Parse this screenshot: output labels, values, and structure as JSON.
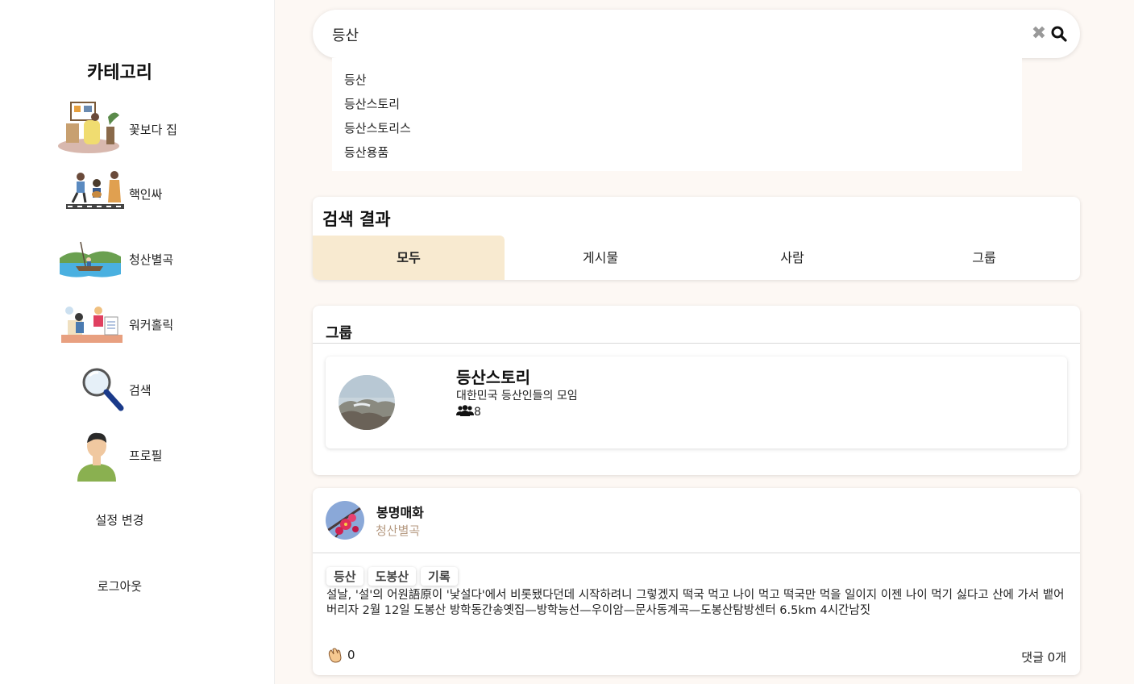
{
  "sidebar": {
    "title": "카테고리",
    "categories": [
      {
        "label": "꽃보다 집",
        "icon": "home-interior-illustration"
      },
      {
        "label": "핵인싸",
        "icon": "music-party-illustration"
      },
      {
        "label": "청산별곡",
        "icon": "boat-nature-illustration"
      },
      {
        "label": "워커홀릭",
        "icon": "office-work-illustration"
      },
      {
        "label": "검색",
        "icon": "magnifier-illustration"
      },
      {
        "label": "프로필",
        "icon": "person-illustration"
      }
    ],
    "settings_label": "설정 변경",
    "logout_label": "로그아웃"
  },
  "search": {
    "value": "등산",
    "suggestions": [
      "등산",
      "등산스토리",
      "등산스토리스",
      "등산용품"
    ]
  },
  "results": {
    "title": "검색 결과",
    "tabs": [
      {
        "label": "모두",
        "active": true
      },
      {
        "label": "게시물",
        "active": false
      },
      {
        "label": "사람",
        "active": false
      },
      {
        "label": "그룹",
        "active": false
      }
    ]
  },
  "groups": {
    "section_title": "그룹",
    "items": [
      {
        "name": "등산스토리",
        "description": "대한민국 등산인들의 모임",
        "members": "8"
      }
    ]
  },
  "post": {
    "author": "봉명매화",
    "category": "청산별곡",
    "tags": [
      "등산",
      "도봉산",
      "기록"
    ],
    "body": "설날, '설'의 어원語原이 '낯설다'에서 비롯됐다던데 시작하려니 그렇겠지 떡국 먹고 나이 먹고 떡국만 먹을 일이지 이젠 나이 먹기 싫다고 산에 가서 뱉어버리자 2월 12일 도봉산 방학동간송옛집—방학능선—우이암—문사동계곡—도봉산탐방센터 6.5km 4시간남짓",
    "likes": "0",
    "comments": "댓글 0개"
  },
  "colors": {
    "background": "#fdf8f4",
    "active_tab": "#f8ead0",
    "category_text": "#b59980"
  }
}
